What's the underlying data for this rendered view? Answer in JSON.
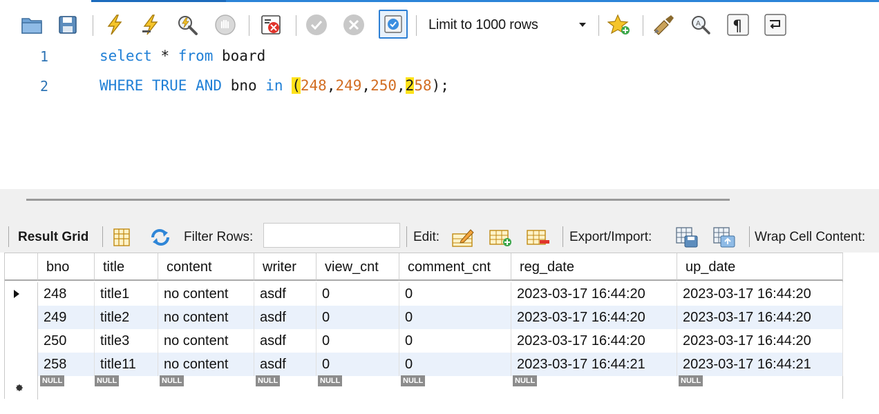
{
  "toolbar": {
    "icons": [
      "open-folder-icon",
      "save-icon",
      "execute-icon",
      "execute-current-icon",
      "explain-icon",
      "stop-icon",
      "toggle-error-icon",
      "commit-icon",
      "rollback-icon",
      "autocommit-icon",
      "bookmark-icon",
      "beautify-icon",
      "find-icon",
      "invisible-chars-icon",
      "wrap-icon"
    ],
    "limit_label": "Limit to 1000 rows"
  },
  "editor": {
    "lines": [
      {
        "number": "1",
        "text": "select * from board"
      },
      {
        "number": "2",
        "text": "WHERE TRUE AND bno in (248,249,250,258);"
      }
    ],
    "tokens": {
      "l1_kw1": "select",
      "l1_star": " * ",
      "l1_kw2": "from",
      "l1_rest": " board",
      "l2_kw1": "WHERE",
      "l2_sp1": " ",
      "l2_kw2": "TRUE",
      "l2_sp2": " ",
      "l2_kw3": "AND",
      "l2_mid": " bno ",
      "l2_kw4": "in",
      "l2_sp3": " ",
      "l2_open": "(",
      "l2_n1": "248",
      "l2_c1": ",",
      "l2_n2": "249",
      "l2_c2": ",",
      "l2_n3": "250",
      "l2_c3": ",",
      "l2_n4a": "2",
      "l2_n4b": "58",
      "l2_close": ");"
    }
  },
  "result_toolbar": {
    "result_grid": "Result Grid",
    "filter_rows": "Filter Rows:",
    "filter_value": "",
    "edit": "Edit:",
    "export_import": "Export/Import:",
    "wrap": "Wrap Cell Content:"
  },
  "grid": {
    "columns": [
      "bno",
      "title",
      "content",
      "writer",
      "view_cnt",
      "comment_cnt",
      "reg_date",
      "up_date"
    ],
    "rows": [
      [
        "248",
        "title1",
        "no content",
        "asdf",
        "0",
        "0",
        "2023-03-17 16:44:20",
        "2023-03-17 16:44:20"
      ],
      [
        "249",
        "title2",
        "no content",
        "asdf",
        "0",
        "0",
        "2023-03-17 16:44:20",
        "2023-03-17 16:44:20"
      ],
      [
        "250",
        "title3",
        "no content",
        "asdf",
        "0",
        "0",
        "2023-03-17 16:44:20",
        "2023-03-17 16:44:20"
      ],
      [
        "258",
        "title11",
        "no content",
        "asdf",
        "0",
        "0",
        "2023-03-17 16:44:21",
        "2023-03-17 16:44:21"
      ]
    ],
    "null_label": "NULL"
  },
  "colors": {
    "keyword": "#1f7fd6",
    "number": "#d26d22",
    "highlight": "#ffe21a",
    "alt_row": "#eaf1fb"
  }
}
